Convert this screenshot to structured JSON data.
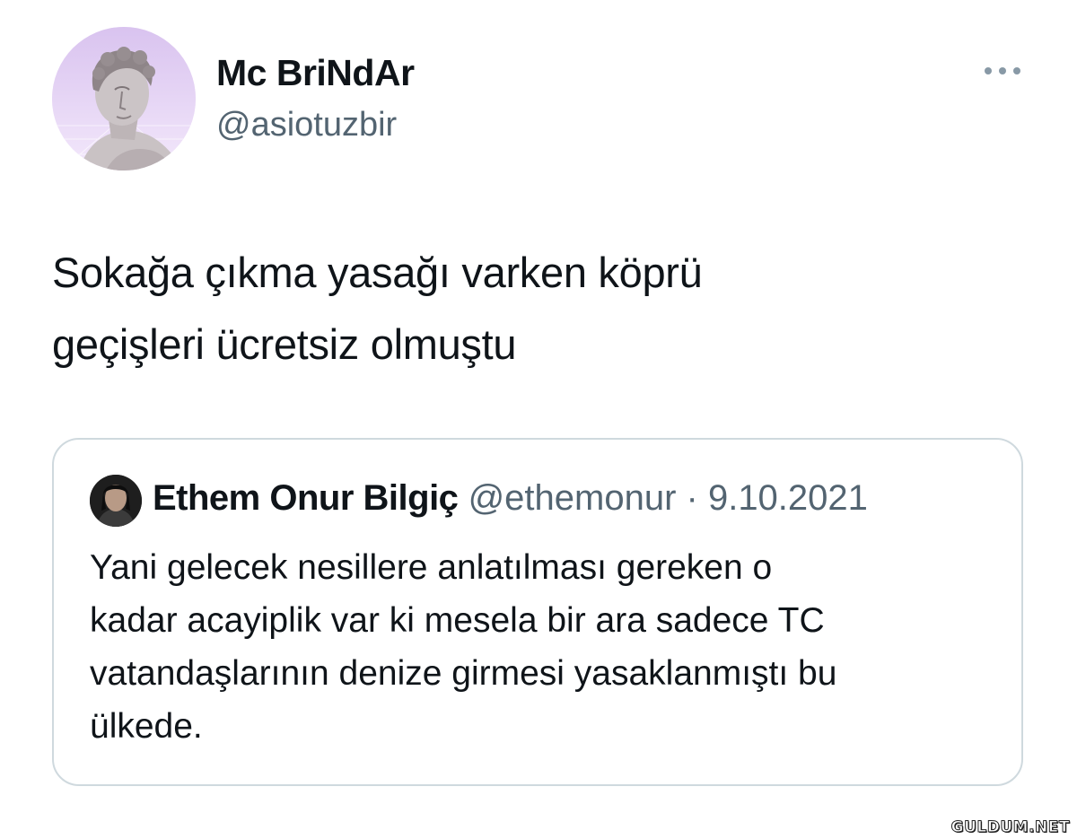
{
  "author": {
    "display_name": "Mc BriNdAr",
    "handle": "@asiotuzbir",
    "avatar_icon": "statue-avatar-icon"
  },
  "more_icon": "more-options-icon",
  "tweet": {
    "lines": [
      "Sokağa çıkma yasağı varken köprü",
      "geçişleri ücretsiz olmuştu"
    ]
  },
  "quoted_tweet": {
    "display_name": "Ethem Onur Bilgiç",
    "handle": "@ethemonur",
    "separator": " · ",
    "date": "9.10.2021",
    "lines": [
      "Yani gelecek nesillere anlatılması gereken o",
      "kadar acayiplik var ki mesela bir ara sadece TC",
      "vatandaşlarının denize girmesi yasaklanmıştı bu",
      "ülkede."
    ]
  },
  "watermark": "GULDUM.NET",
  "colors": {
    "text_primary": "#0f1419",
    "text_secondary": "#536471",
    "border": "#cfd9de",
    "avatar_bg": "#e8d7f5"
  }
}
